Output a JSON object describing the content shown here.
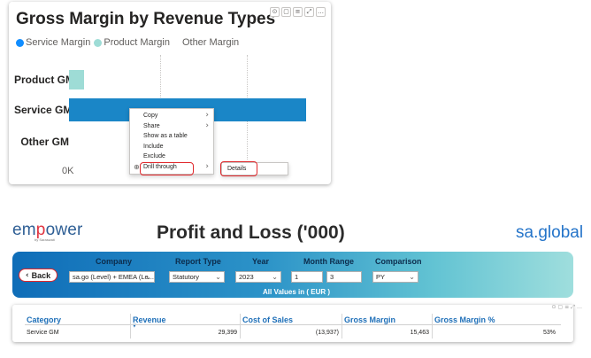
{
  "chart": {
    "title": "Gross Margin by Revenue Types",
    "visual_header_icons": [
      "pin-icon",
      "copy-icon",
      "filter-icon",
      "focus-mode-icon",
      "more-options-icon"
    ],
    "legend": [
      {
        "label": "Service Margin",
        "color": "#118DFF"
      },
      {
        "label": "Product Margin",
        "color": "#9EDCD6"
      },
      {
        "label": "Other Margin",
        "color": null
      }
    ],
    "tick_label": "0K"
  },
  "chart_data": {
    "type": "bar",
    "orientation": "horizontal",
    "title": "Gross Margin by Revenue Types",
    "categories": [
      "Product GM",
      "Service GM",
      "Other GM"
    ],
    "series": [
      {
        "name": "Product Margin",
        "values": [
          1000,
          0,
          0
        ]
      },
      {
        "name": "Service Margin",
        "values": [
          0,
          15463,
          0
        ]
      },
      {
        "name": "Other Margin",
        "values": [
          0,
          0,
          0
        ]
      }
    ],
    "x_tick_labels": [
      "0K"
    ],
    "xlim": [
      0,
      15463
    ],
    "legend_position": "top-left",
    "colors": {
      "Service Margin": "#118DFF",
      "Product Margin": "#9EDCD6"
    }
  },
  "context_menu": {
    "items": [
      {
        "label": "Copy",
        "has_submenu": true
      },
      {
        "label": "Share",
        "has_submenu": true
      },
      {
        "label": "Show as a table",
        "has_submenu": false
      },
      {
        "label": "Include",
        "has_submenu": false
      },
      {
        "label": "Exclude",
        "has_submenu": false
      },
      {
        "label": "Drill through",
        "has_submenu": true
      }
    ],
    "submenu_item": "Details"
  },
  "report": {
    "logo_left": {
      "pre": "em",
      "accent": "p",
      "post": "ower",
      "tagline": "by Saraswati"
    },
    "title": "Profit and Loss ('000)",
    "logo_right": "sa.global",
    "back_label": "Back",
    "filters": {
      "company_label": "Company",
      "company_value": "sa.go (Level) + EMEA (Le...",
      "report_type_label": "Report Type",
      "report_type_value": "Statutory",
      "year_label": "Year",
      "year_value": "2023",
      "month_range_label": "Month Range",
      "month_from": "1",
      "month_to": "3",
      "comparison_label": "Comparison",
      "comparison_value": "PY"
    },
    "values_note": "All Values in ( EUR )",
    "table": {
      "headers": [
        "Category",
        "Revenue",
        "Cost of Sales",
        "Gross Margin",
        "Gross Margin %"
      ],
      "rows": [
        [
          "Service GM",
          "29,399",
          "(13,937)",
          "15,463",
          "53%"
        ]
      ]
    },
    "banner_gradient": [
      "#0f6db8",
      "#9fdedd"
    ],
    "accent_color": "#e0262a"
  }
}
